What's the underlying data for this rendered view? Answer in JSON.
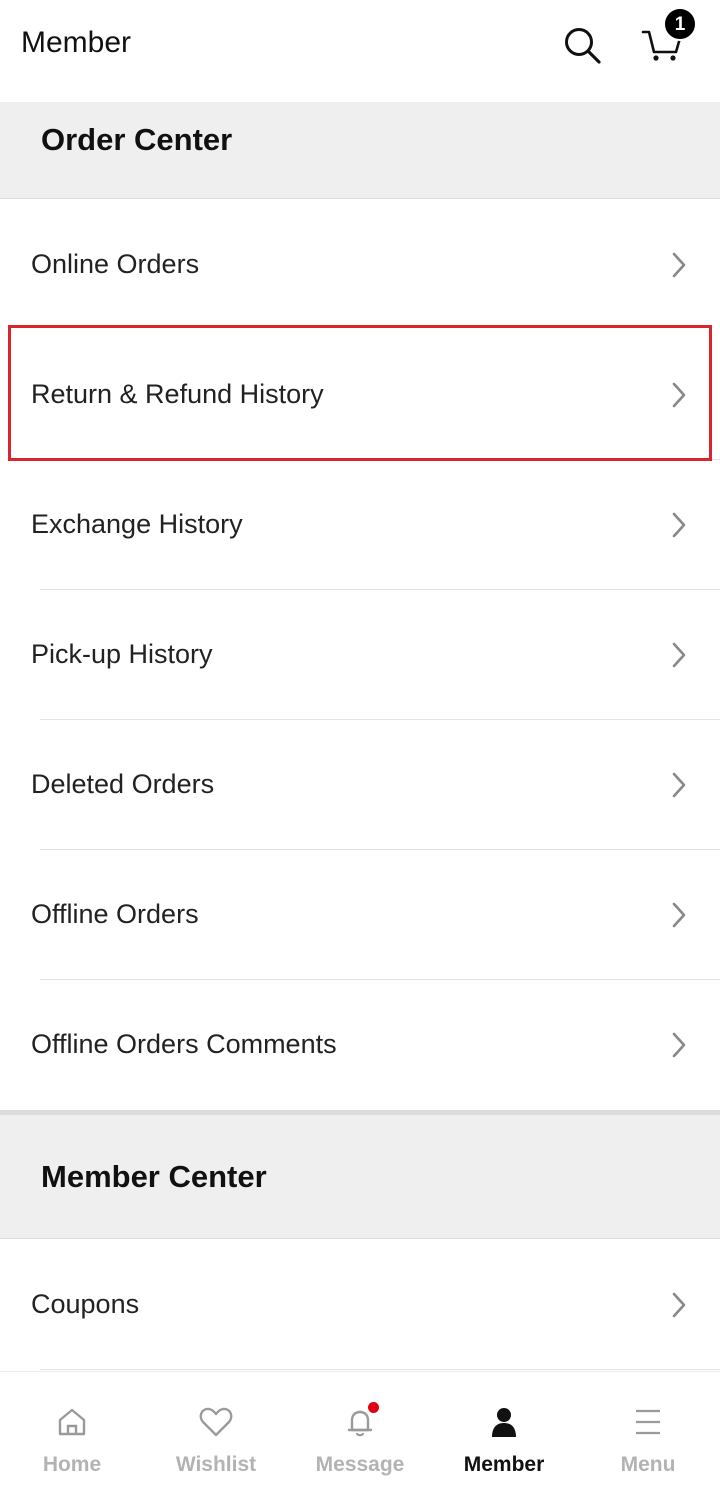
{
  "header": {
    "title": "Member",
    "cart_count": "1",
    "icons": {
      "search": "search-icon",
      "cart": "cart-icon"
    }
  },
  "order_center": {
    "title": "Order Center",
    "items": [
      {
        "label": "Online Orders"
      },
      {
        "label": "Return & Refund History",
        "highlighted": true
      },
      {
        "label": "Exchange History"
      },
      {
        "label": "Pick-up History"
      },
      {
        "label": "Deleted Orders"
      },
      {
        "label": "Offline Orders"
      },
      {
        "label": "Offline Orders Comments"
      }
    ]
  },
  "member_center": {
    "title": "Member Center",
    "items": [
      {
        "label": "Coupons"
      }
    ]
  },
  "tabbar": {
    "tabs": [
      {
        "label": "Home",
        "icon": "home-icon",
        "active": false
      },
      {
        "label": "Wishlist",
        "icon": "heart-icon",
        "active": false
      },
      {
        "label": "Message",
        "icon": "bell-icon",
        "active": false,
        "notification_dot": true
      },
      {
        "label": "Member",
        "icon": "person-icon",
        "active": true
      },
      {
        "label": "Menu",
        "icon": "menu-icon",
        "active": false
      }
    ]
  },
  "colors": {
    "highlight_border": "#d9262e",
    "section_background": "#efefef",
    "notification_dot": "#e00014",
    "inactive_tab": "#b3b3b3"
  }
}
